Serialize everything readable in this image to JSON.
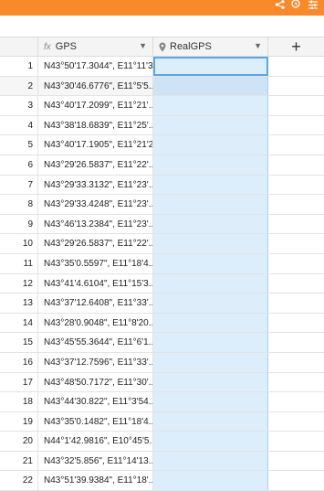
{
  "colors": {
    "accent": "#f98a2c",
    "selection": "#dceefc",
    "selection_border": "#5aa6e6"
  },
  "toolbar": {
    "icons": [
      "share-icon",
      "history-icon",
      "settings-sliders-icon"
    ]
  },
  "columns": [
    {
      "label": "GPS",
      "type_icon": "fx",
      "type": "formula"
    },
    {
      "label": "RealGPS",
      "type_icon": "location-pin-icon",
      "type": "location"
    }
  ],
  "add_column_label": "+",
  "rows": [
    {
      "n": "1",
      "gps": "N43°50'17.3044\", E11°11'3..."
    },
    {
      "n": "2",
      "gps": "N43°30'46.6776\", E11°5'5..."
    },
    {
      "n": "3",
      "gps": "N43°40'17.2099\", E11°21'..."
    },
    {
      "n": "4",
      "gps": "N43°38'18.6839\", E11°25'..."
    },
    {
      "n": "5",
      "gps": "N43°40'17.1905\", E11°21'2..."
    },
    {
      "n": "6",
      "gps": "N43°29'26.5837\", E11°22'..."
    },
    {
      "n": "7",
      "gps": "N43°29'33.3132\", E11°23'..."
    },
    {
      "n": "8",
      "gps": "N43°29'33.4248\", E11°23'..."
    },
    {
      "n": "9",
      "gps": "N43°46'13.2384\", E11°23'..."
    },
    {
      "n": "10",
      "gps": "N43°29'26.5837\", E11°22'..."
    },
    {
      "n": "11",
      "gps": "N43°35'0.5597\", E11°18'4..."
    },
    {
      "n": "12",
      "gps": "N43°41'4.6104\", E11°15'3..."
    },
    {
      "n": "13",
      "gps": "N43°37'12.6408\", E11°33'..."
    },
    {
      "n": "14",
      "gps": "N43°28'0.9048\", E11°8'20..."
    },
    {
      "n": "15",
      "gps": "N43°45'55.3644\", E11°6'1..."
    },
    {
      "n": "16",
      "gps": "N43°37'12.7596\", E11°33'..."
    },
    {
      "n": "17",
      "gps": "N43°48'50.7172\", E11°30'..."
    },
    {
      "n": "18",
      "gps": "N43°44'30.822\", E11°3'54..."
    },
    {
      "n": "19",
      "gps": "N43°35'0.1482\", E11°18'4..."
    },
    {
      "n": "20",
      "gps": "N44°1'42.9816\", E10°45'5..."
    },
    {
      "n": "21",
      "gps": "N43°32'5.856\", E11°14'13..."
    },
    {
      "n": "22",
      "gps": "N43°51'39.9384\", E11°18'..."
    }
  ]
}
